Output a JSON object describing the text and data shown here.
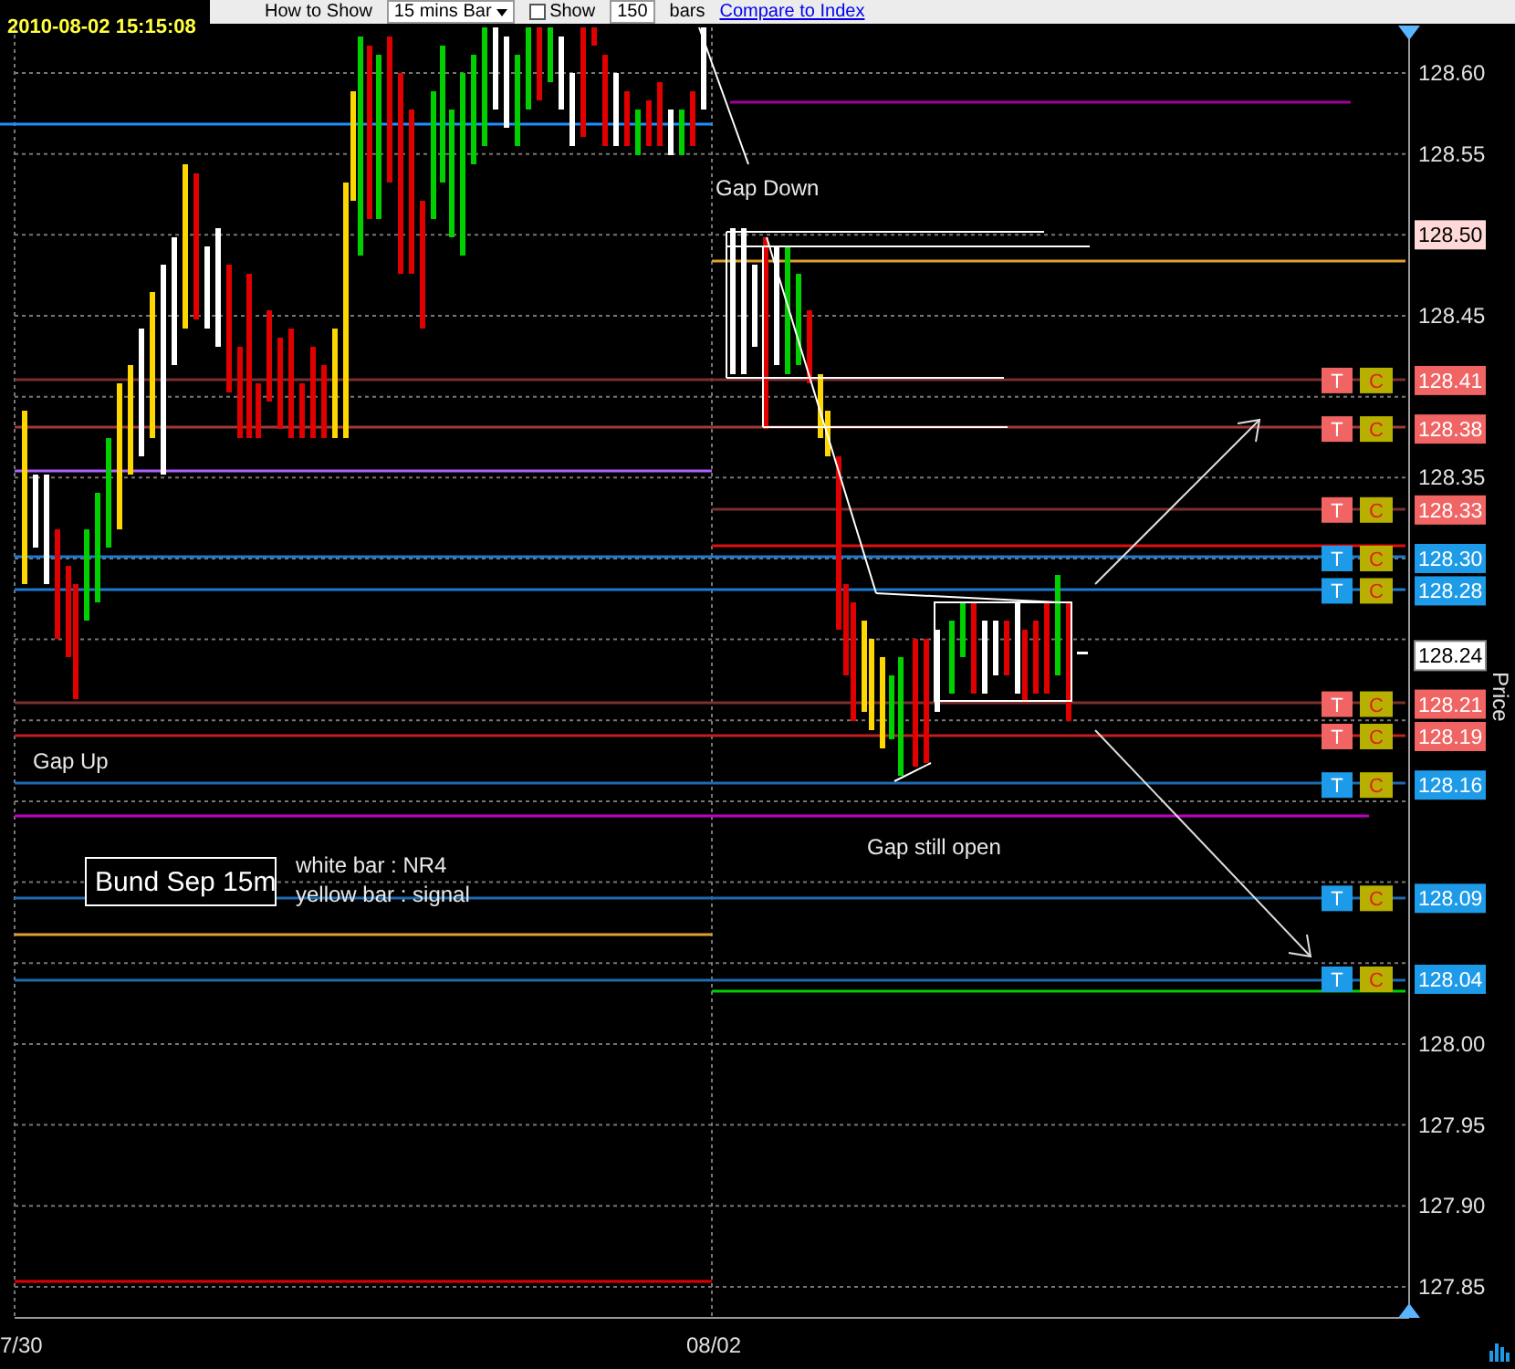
{
  "timestamp": "2010-08-02 15:15:08",
  "toolbar": {
    "items": [
      {
        "kind": "label",
        "text": "How to Show"
      },
      {
        "kind": "select",
        "text": "15 mins Bar"
      },
      {
        "kind": "checkbox",
        "text": "Show",
        "checked": false
      },
      {
        "kind": "field",
        "text": "150"
      },
      {
        "kind": "label",
        "text": "bars"
      },
      {
        "kind": "link",
        "text": "Compare to Index"
      }
    ]
  },
  "price_axis": {
    "title": "Price",
    "ticks": [
      "128.60",
      "128.55",
      "128.45",
      "128.35",
      "128.00",
      "127.95",
      "127.90",
      "127.85"
    ]
  },
  "time_axis": {
    "labels": [
      "7/30",
      "08/02"
    ]
  },
  "price_tags": [
    {
      "kind": "marker",
      "label": "128.50"
    },
    {
      "kind": "order",
      "label": "128.41",
      "color": "#f06464",
      "buttons": [
        "T",
        "C"
      ]
    },
    {
      "kind": "order",
      "label": "128.38",
      "color": "#f06464",
      "buttons": [
        "T",
        "C"
      ]
    },
    {
      "kind": "order",
      "label": "128.33",
      "color": "#f06464",
      "buttons": [
        "T",
        "C"
      ]
    },
    {
      "kind": "order",
      "label": "128.30",
      "color": "#1e9be8",
      "buttons": [
        "T",
        "C"
      ]
    },
    {
      "kind": "order",
      "label": "128.28",
      "color": "#1e9be8",
      "buttons": [
        "T",
        "C"
      ]
    },
    {
      "kind": "current",
      "label": "128.24"
    },
    {
      "kind": "order",
      "label": "128.21",
      "color": "#f06464",
      "buttons": [
        "T",
        "C"
      ]
    },
    {
      "kind": "order",
      "label": "128.19",
      "color": "#f06464",
      "buttons": [
        "T",
        "C"
      ]
    },
    {
      "kind": "order",
      "label": "128.16",
      "color": "#1e9be8",
      "buttons": [
        "T",
        "C"
      ]
    },
    {
      "kind": "order",
      "label": "128.09",
      "color": "#1e9be8",
      "buttons": [
        "T",
        "C"
      ]
    },
    {
      "kind": "order",
      "label": "128.04",
      "color": "#1e9be8",
      "buttons": [
        "T",
        "C"
      ]
    }
  ],
  "annotations": [
    {
      "kind": "note",
      "text": "Gap Down"
    },
    {
      "kind": "note",
      "text": "Gap Up"
    },
    {
      "kind": "note",
      "text": "Gap still open"
    },
    {
      "kind": "title",
      "text": "Bund Sep 15m"
    },
    {
      "kind": "legend",
      "text": "white bar : NR4"
    },
    {
      "kind": "legend",
      "text": "yellow bar : signal"
    }
  ]
}
